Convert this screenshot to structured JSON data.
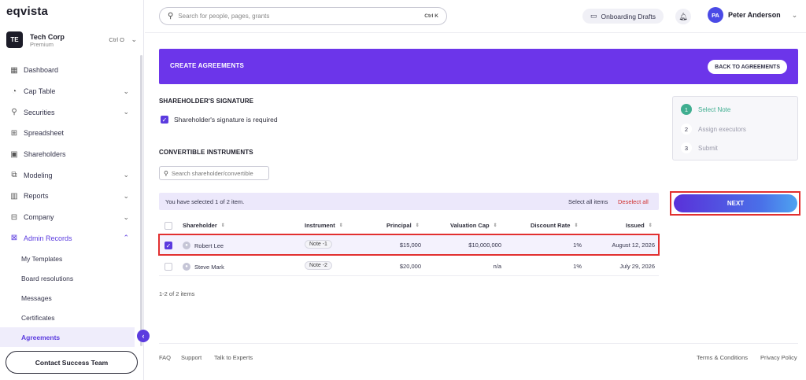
{
  "app": {
    "logo": "eqvista"
  },
  "company": {
    "initials": "TE",
    "name": "Tech Corp",
    "plan": "Premium",
    "shortcut": "Ctrl O"
  },
  "sidebar": {
    "items": [
      {
        "label": "Dashboard"
      },
      {
        "label": "Cap Table"
      },
      {
        "label": "Securities"
      },
      {
        "label": "Spreadsheet"
      },
      {
        "label": "Shareholders"
      },
      {
        "label": "Modeling"
      },
      {
        "label": "Reports"
      },
      {
        "label": "Company"
      },
      {
        "label": "Admin Records"
      }
    ],
    "subitems": [
      {
        "label": "My Templates"
      },
      {
        "label": "Board resolutions"
      },
      {
        "label": "Messages"
      },
      {
        "label": "Certificates"
      },
      {
        "label": "Agreements"
      }
    ],
    "contact_label": "Contact Success Team"
  },
  "header": {
    "search_placeholder": "Search for people, pages, grants",
    "search_shortcut": "Ctrl K",
    "drafts_label": "Onboarding Drafts",
    "user_initials": "PA",
    "user_name": "Peter Anderson"
  },
  "banner": {
    "title": "CREATE AGREEMENTS",
    "back_label": "BACK TO AGREEMENTS"
  },
  "signature": {
    "title": "SHAREHOLDER'S SIGNATURE",
    "checkbox_label": "Shareholder's signature is required"
  },
  "instruments": {
    "title": "CONVERTIBLE INSTRUMENTS",
    "search_placeholder": "Search shareholder/convertible",
    "selection_text": "You have selected 1 of 2 item.",
    "select_all": "Select all items",
    "deselect_all": "Deselect all",
    "columns": {
      "shareholder": "Shareholder",
      "instrument": "Instrument",
      "principal": "Principal",
      "valuation_cap": "Valuation Cap",
      "discount_rate": "Discount Rate",
      "issued": "Issued"
    },
    "rows": [
      {
        "shareholder": "Robert Lee",
        "instrument": "Note -1",
        "principal": "$15,000",
        "valuation_cap": "$10,000,000",
        "discount_rate": "1%",
        "issued": "August 12, 2026"
      },
      {
        "shareholder": "Steve Mark",
        "instrument": "Note -2",
        "principal": "$20,000",
        "valuation_cap": "n/a",
        "discount_rate": "1%",
        "issued": "July 29, 2026"
      }
    ],
    "count_text": "1-2 of 2 items"
  },
  "stepper": {
    "steps": [
      {
        "num": "1",
        "label": "Select Note"
      },
      {
        "num": "2",
        "label": "Assign executors"
      },
      {
        "num": "3",
        "label": "Submit"
      }
    ],
    "next_label": "NEXT"
  },
  "footer": {
    "faq": "FAQ",
    "support": "Support",
    "experts": "Talk to Experts",
    "terms": "Terms & Conditions",
    "privacy": "Privacy Policy"
  },
  "colors": {
    "accent": "#5b3bdf",
    "banner": "#6c35ea",
    "step_active": "#3fae90",
    "highlight": "#e23030"
  }
}
